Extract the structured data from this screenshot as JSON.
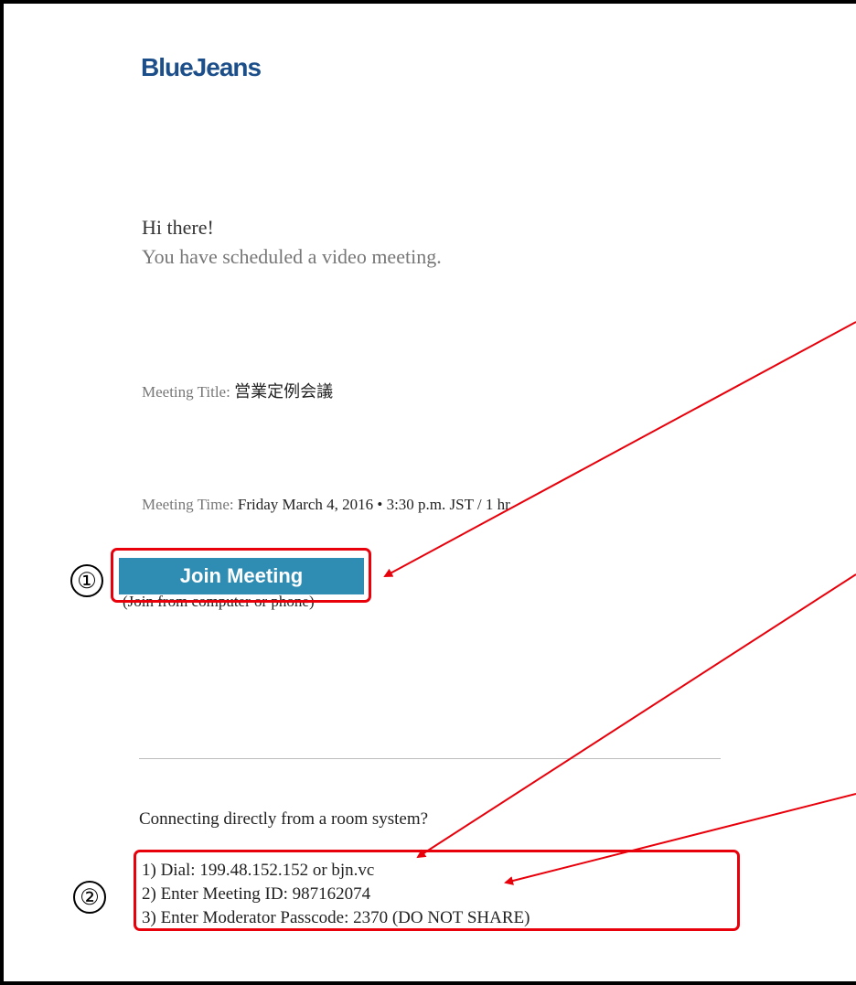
{
  "brand": {
    "logo": "BlueJeans"
  },
  "greeting": {
    "line1": "Hi there!",
    "line2": "You have scheduled a video meeting."
  },
  "meeting": {
    "title_label": "Meeting Title:",
    "title_value": "営業定例会議",
    "time_label": "Meeting Time:",
    "time_value": "Friday March 4, 2016 • 3:30 p.m. JST / 1 hr"
  },
  "join": {
    "button_label": "Join Meeting",
    "note": "(Join from computer or phone)"
  },
  "room": {
    "question": "Connecting directly from a room system?",
    "steps": [
      "1) Dial: 199.48.152.152 or bjn.vc",
      "2) Enter Meeting ID: 987162074",
      "3) Enter Moderator Passcode: 2370 (DO NOT SHARE)"
    ]
  },
  "annotations": {
    "badge1": "①",
    "badge2": "②",
    "highlight_color": "#e8000b"
  }
}
